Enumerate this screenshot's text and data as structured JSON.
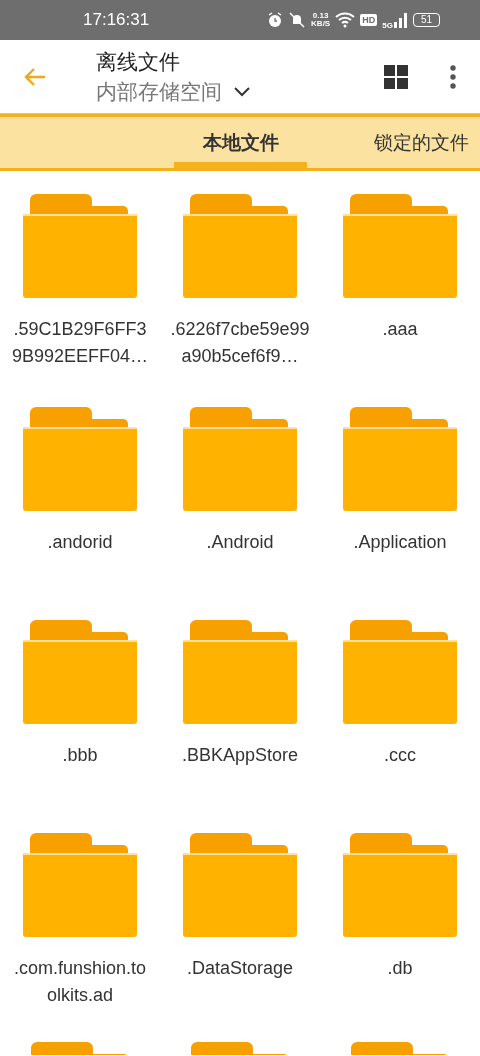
{
  "status_bar": {
    "time": "17:16:31",
    "speed_value": "0.13",
    "speed_unit": "KB/S",
    "hd": "HD",
    "network": "5G",
    "battery": "51"
  },
  "header": {
    "title": "离线文件",
    "location": "内部存储空间"
  },
  "tabs": [
    {
      "label": "本地文件",
      "selected": true
    },
    {
      "label": "锁定的文件",
      "selected": false
    }
  ],
  "folders": [
    {
      "kind": "full",
      "name": ".59C1B29F6FF39B992EEFF04…"
    },
    {
      "kind": "full",
      "name": ".6226f7cbe59e99a90b5cef6f9…"
    },
    {
      "kind": "full",
      "name": ".aaa"
    },
    {
      "kind": "full",
      "name": ".andorid"
    },
    {
      "kind": "full",
      "name": ".Android"
    },
    {
      "kind": "full",
      "name": ".Application"
    },
    {
      "kind": "full",
      "name": ".bbb"
    },
    {
      "kind": "full",
      "name": ".BBKAppStore"
    },
    {
      "kind": "full",
      "name": ".ccc"
    },
    {
      "kind": "full",
      "name": ".com.funshion.toolkits.ad"
    },
    {
      "kind": "full",
      "name": ".DataStorage"
    },
    {
      "kind": "full",
      "name": ".db"
    },
    {
      "kind": "cut"
    },
    {
      "kind": "cut"
    },
    {
      "kind": "cut"
    }
  ]
}
